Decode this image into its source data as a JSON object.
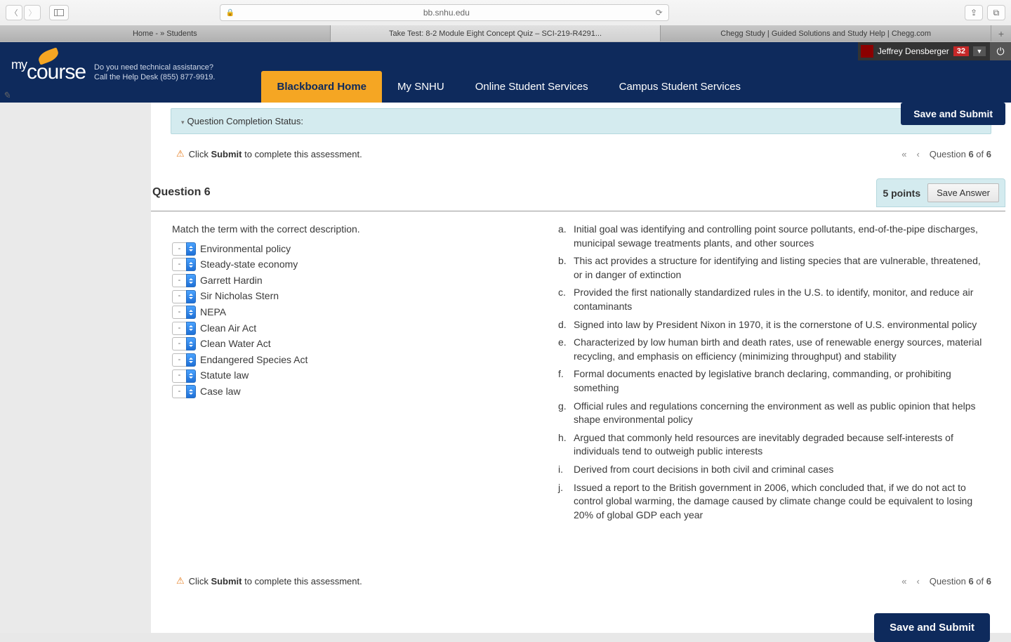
{
  "browser": {
    "url": "bb.snhu.edu",
    "tabs": [
      "Home - » Students",
      "Take Test: 8-2 Module Eight Concept Quiz – SCI-219-R4291...",
      "Chegg Study | Guided Solutions and Study Help | Chegg.com"
    ]
  },
  "header": {
    "logo_my": "my",
    "logo_course": "course",
    "help_line1": "Do you need technical assistance?",
    "help_line2": "Call the Help Desk (855) 877-9919.",
    "nav": [
      "Blackboard Home",
      "My SNHU",
      "Online Student Services",
      "Campus Student Services"
    ],
    "user_name": "Jeffrey Densberger",
    "badge": "32"
  },
  "status_bar": "Question Completion Status:",
  "submit_note_pre": "Click ",
  "submit_note_bold": "Submit",
  "submit_note_post": " to complete this assessment.",
  "qnav": {
    "label_pre": "Question ",
    "current": "6",
    "of": " of ",
    "total": "6"
  },
  "question": {
    "title": "Question 6",
    "points": "5 points",
    "save_answer": "Save Answer",
    "prompt": "Match the term with the correct description.",
    "terms": [
      "Environmental policy",
      "Steady-state economy",
      "Garrett Hardin",
      "Sir Nicholas Stern",
      "NEPA",
      "Clean Air Act",
      "Clean Water Act",
      "Endangered Species Act",
      "Statute law",
      "Case law"
    ],
    "select_placeholder": "-",
    "descriptions": [
      {
        "l": "a.",
        "t": "Initial goal was identifying and controlling point source pollutants, end-of-the-pipe discharges, municipal sewage treatments plants, and other sources"
      },
      {
        "l": "b.",
        "t": "This act provides a structure for identifying and listing species that are vulnerable, threatened, or in danger of extinction"
      },
      {
        "l": "c.",
        "t": "Provided the first nationally standardized rules in the U.S. to identify, monitor, and reduce air contaminants"
      },
      {
        "l": "d.",
        "t": "Signed into law by President Nixon in 1970, it is the cornerstone of U.S. environmental policy"
      },
      {
        "l": "e.",
        "t": "Characterized by low human birth and death rates, use of renewable energy sources, material recycling, and emphasis on efficiency (minimizing throughput) and stability"
      },
      {
        "l": "f.",
        "t": "Formal documents enacted by legislative branch declaring, commanding, or prohibiting something"
      },
      {
        "l": "g.",
        "t": "Official rules and regulations concerning the environment as well as public opinion that helps shape environmental policy"
      },
      {
        "l": "h.",
        "t": "Argued that commonly held resources are inevitably degraded because self-interests of individuals tend to outweigh public interests"
      },
      {
        "l": "i.",
        "t": "Derived from court decisions in both civil and criminal cases"
      },
      {
        "l": "j.",
        "t": "Issued a report to the British government in 2006, which concluded that, if we do not act to control global warming, the damage caused by climate change could be equivalent to losing 20% of global GDP each year"
      }
    ]
  },
  "save_submit": "Save and Submit"
}
